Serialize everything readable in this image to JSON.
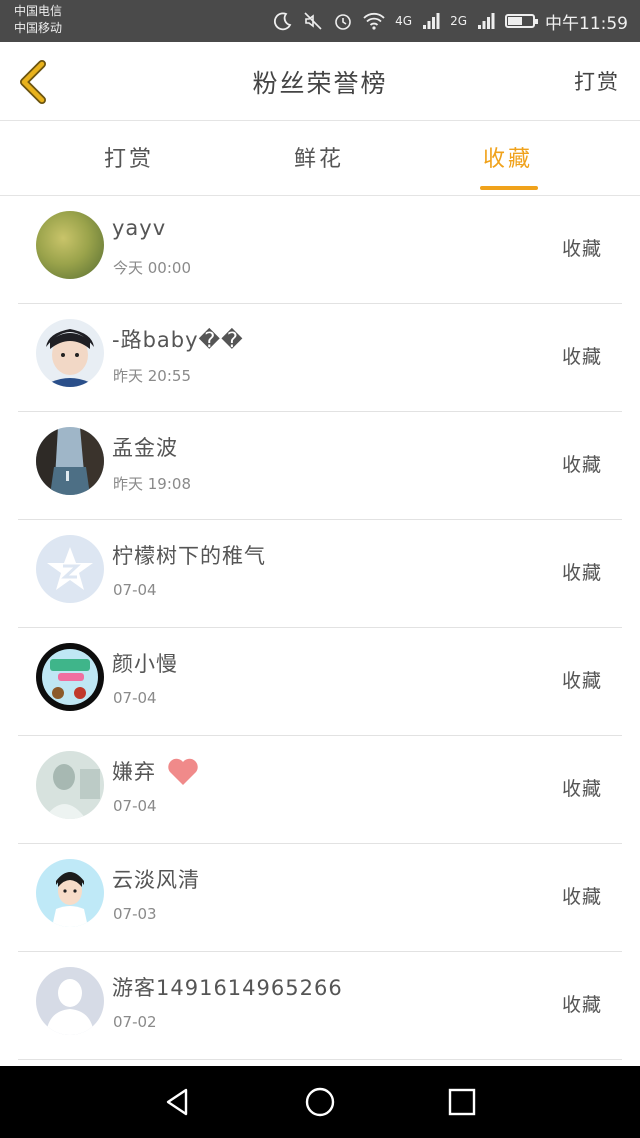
{
  "status_bar": {
    "carrier_1": "中国电信",
    "carrier_2": "中国移动",
    "network_1": "4G",
    "network_2": "2G",
    "battery_level": 0.55,
    "time": "中午11:59"
  },
  "header": {
    "title": "粉丝荣誉榜",
    "right_action": "打赏"
  },
  "tabs": [
    {
      "label": "打赏",
      "active": false
    },
    {
      "label": "鲜花",
      "active": false
    },
    {
      "label": "收藏",
      "active": true
    }
  ],
  "fans": [
    {
      "name": "yayv",
      "time": "今天 00:00",
      "action": "收藏"
    },
    {
      "name": "-路baby��",
      "time": "昨天 20:55",
      "action": "收藏"
    },
    {
      "name": "孟金波",
      "time": "昨天 19:08",
      "action": "收藏"
    },
    {
      "name": "柠檬树下的稚气",
      "time": "07-04",
      "action": "收藏"
    },
    {
      "name": "颜小慢",
      "time": "07-04",
      "action": "收藏"
    },
    {
      "name": "嫌弃",
      "time": "07-04",
      "action": "收藏"
    },
    {
      "name": "云淡风清",
      "time": "07-03",
      "action": "收藏"
    },
    {
      "name": "游客1491614965266",
      "time": "07-02",
      "action": "收藏"
    }
  ],
  "colors": {
    "accent": "#f0a21b",
    "back_arrow": "#e8b21c",
    "heart": "#f08a8a"
  },
  "icons": {
    "back": "chevron-left-icon",
    "android_back": "triangle-back-icon",
    "android_home": "circle-home-icon",
    "android_recents": "square-recents-icon"
  }
}
